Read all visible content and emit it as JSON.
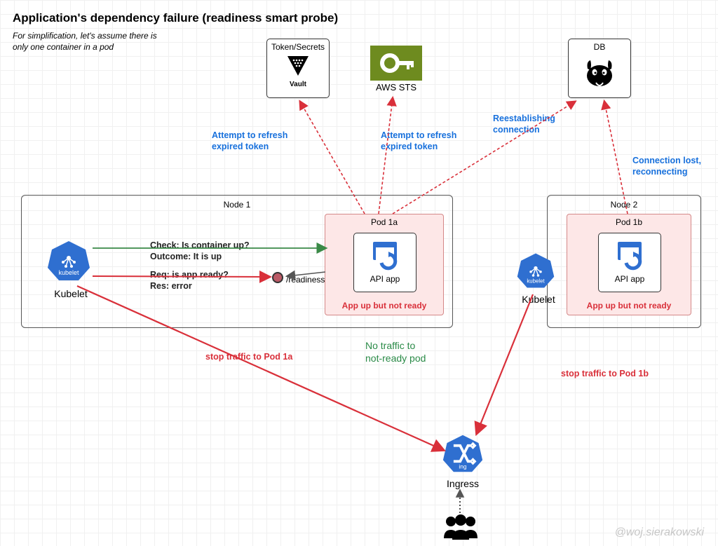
{
  "title": "Application's dependency failure (readiness smart probe)",
  "subtitle1": "For simplification, let's assume there is",
  "subtitle2": "only one container in a pod",
  "deps": {
    "vault": {
      "header": "Token/Secrets",
      "brand": "Vault"
    },
    "sts": {
      "label": "AWS STS"
    },
    "db": {
      "header": "DB"
    }
  },
  "nodes": {
    "n1": {
      "label": "Node 1"
    },
    "n2": {
      "label": "Node 2"
    }
  },
  "pods": {
    "p1a": {
      "label": "Pod 1a",
      "app": "API app",
      "status": "App up but not ready"
    },
    "p1b": {
      "label": "Pod 1b",
      "app": "API app",
      "status": "App up but not ready"
    }
  },
  "kubelet": {
    "label": "Kubelet"
  },
  "ingress": {
    "label": "Ingress"
  },
  "annotations": {
    "refresh1": "Attempt to refresh\nexpired token",
    "refresh2": "Attempt to refresh\nexpired token",
    "reestablish": "Reestablishing\nconnection",
    "connlost": "Connection lost,\nreconnecting",
    "check1": "Check: Is container up?",
    "check2": "Outcome: It is up",
    "req1": "Req: is app ready?",
    "req2": "Res: error",
    "readiness_ep": "/readiness",
    "stop1a": "stop traffic to Pod 1a",
    "stop1b": "stop traffic to Pod 1b",
    "notraffic1": "No traffic to",
    "notraffic2": "not-ready pod"
  },
  "author": "@woj.sierakowski"
}
